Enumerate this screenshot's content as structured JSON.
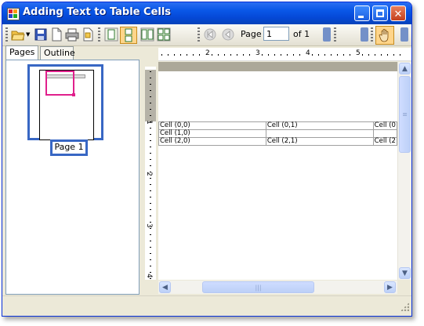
{
  "window": {
    "title": "Adding Text to Table Cells"
  },
  "toolbar": {
    "page_label": "Page",
    "page_value": "1",
    "of_label": "of 1"
  },
  "tabs": [
    {
      "label": "Pages"
    },
    {
      "label": "Outline"
    }
  ],
  "thumbnail": {
    "caption": "Page 1"
  },
  "ruler": {
    "top_numbers": [
      "2",
      "3",
      "4",
      "5"
    ],
    "left_numbers": [
      "1",
      "2",
      "3",
      "4"
    ]
  },
  "table": {
    "rows": [
      [
        "Cell (0,0)",
        "Cell (0,1)",
        "Cell (0"
      ],
      [
        "Cell (1,0)",
        "",
        ""
      ],
      [
        "Cell (2,0)",
        "Cell (2,1)",
        "Cell (2"
      ]
    ]
  },
  "colors": {
    "titlebar": "#0548d6",
    "thumb_highlight": "#3867c4",
    "view_rect": "#e0208c",
    "chrome": "#ece9d8"
  },
  "icons": [
    "open-icon",
    "save-icon",
    "new-page-icon",
    "print-icon",
    "page-setup-icon",
    "single-page-icon",
    "continuous-icon",
    "two-page-icon",
    "multi-page-icon",
    "first-page-icon",
    "prev-page-icon",
    "hand-tool-icon"
  ]
}
